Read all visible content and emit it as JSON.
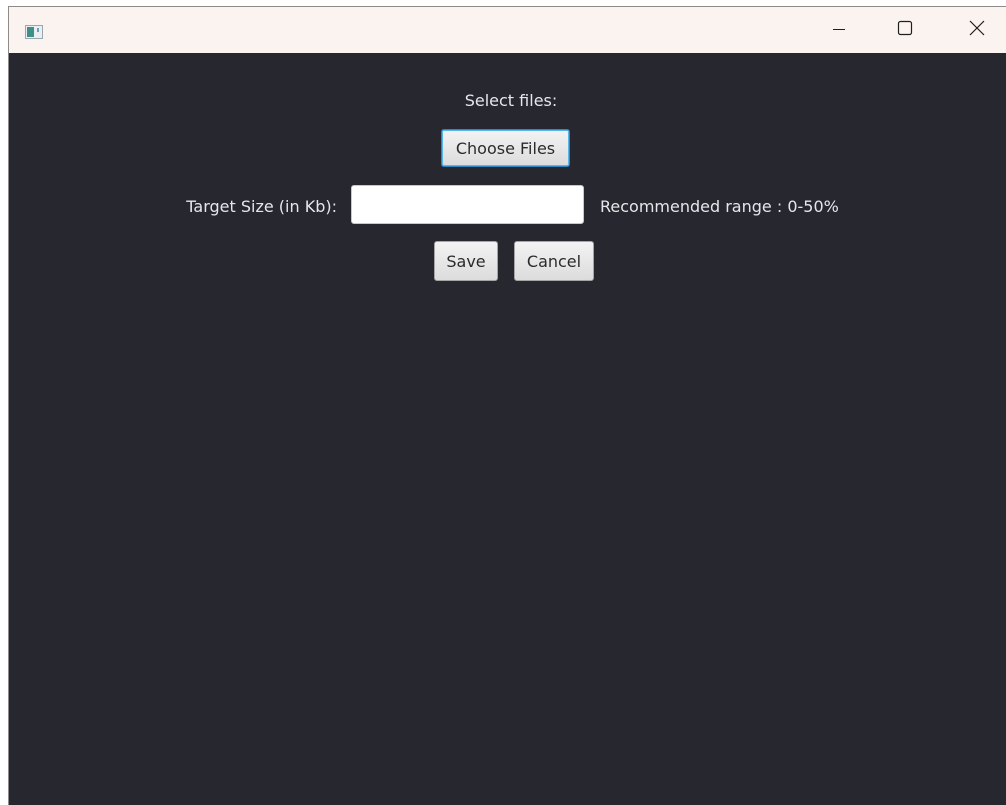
{
  "window": {
    "title": "",
    "controls": {
      "minimize_icon": "minimize-icon",
      "maximize_icon": "maximize-icon",
      "close_icon": "close-icon"
    }
  },
  "form": {
    "select_files_label": "Select files:",
    "choose_files_button": "Choose Files",
    "target_size_label": "Target Size (in Kb):",
    "target_size_value": "",
    "target_size_placeholder": "",
    "recommended_range_label": "Recommended range : 0-50%",
    "save_button": "Save",
    "cancel_button": "Cancel"
  },
  "colors": {
    "titlebar": "#fbf3ef",
    "background": "#272730",
    "text": "#e6e6ea",
    "focus_accent": "#2a88c8"
  }
}
